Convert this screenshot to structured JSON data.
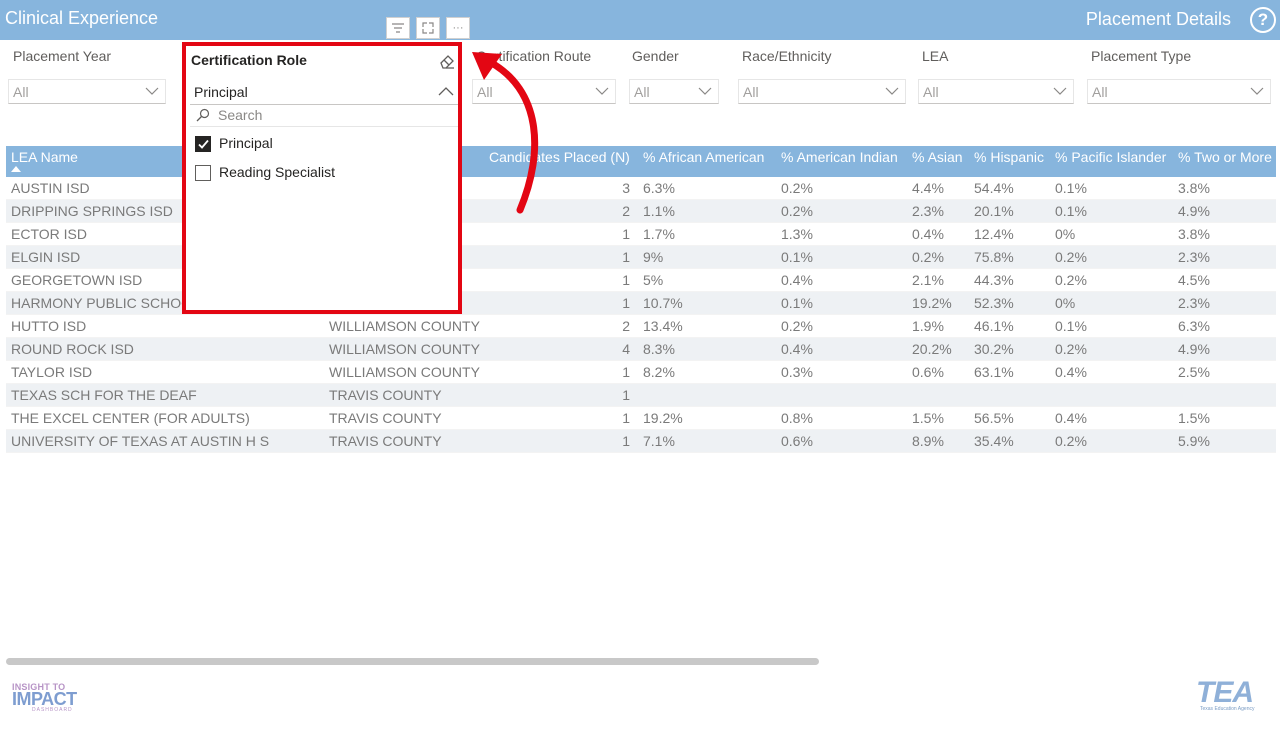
{
  "header": {
    "app_title": "Clinical Experience",
    "page_title": "Placement Details",
    "help_glyph": "?"
  },
  "visual_header": {
    "more_glyph": "···"
  },
  "slicers": [
    {
      "label": "Placement Year",
      "value": "All"
    },
    {
      "label": "Certification Route",
      "value": "All"
    },
    {
      "label": "Gender",
      "value": "All"
    },
    {
      "label": "Race/Ethnicity",
      "value": "All"
    },
    {
      "label": "LEA",
      "value": "All"
    },
    {
      "label": "Placement Type",
      "value": "All"
    }
  ],
  "dropdown": {
    "title": "Certification Role",
    "selected": "Principal",
    "search_placeholder": "Search",
    "items": [
      {
        "label": "Principal",
        "checked": true
      },
      {
        "label": "Reading Specialist",
        "checked": false
      }
    ]
  },
  "table": {
    "headers": [
      "LEA Name",
      "Candidates Placed (N)",
      "% African American",
      "% American Indian",
      "% Asian",
      "% Hispanic",
      "% Pacific Islander",
      "% Two or More"
    ],
    "rows": [
      {
        "lea": "AUSTIN ISD",
        "county": "",
        "n": "3",
        "aa": "6.3%",
        "ai": "0.2%",
        "as": "4.4%",
        "hi": "54.4%",
        "pi": "0.1%",
        "tm": "3.8%"
      },
      {
        "lea": "DRIPPING SPRINGS ISD",
        "county": "",
        "n": "2",
        "aa": "1.1%",
        "ai": "0.2%",
        "as": "2.3%",
        "hi": "20.1%",
        "pi": "0.1%",
        "tm": "4.9%"
      },
      {
        "lea": "ECTOR ISD",
        "county": "",
        "n": "1",
        "aa": "1.7%",
        "ai": "1.3%",
        "as": "0.4%",
        "hi": "12.4%",
        "pi": "0%",
        "tm": "3.8%"
      },
      {
        "lea": "ELGIN ISD",
        "county": "",
        "n": "1",
        "aa": "9%",
        "ai": "0.1%",
        "as": "0.2%",
        "hi": "75.8%",
        "pi": "0.2%",
        "tm": "2.3%"
      },
      {
        "lea": "GEORGETOWN ISD",
        "county": "TY",
        "n": "1",
        "aa": "5%",
        "ai": "0.4%",
        "as": "2.1%",
        "hi": "44.3%",
        "pi": "0.2%",
        "tm": "4.5%"
      },
      {
        "lea": "HARMONY PUBLIC SCHOO",
        "county": "",
        "n": "1",
        "aa": "10.7%",
        "ai": "0.1%",
        "as": "19.2%",
        "hi": "52.3%",
        "pi": "0%",
        "tm": "2.3%"
      },
      {
        "lea": "HUTTO ISD",
        "county": "WILLIAMSON COUNTY",
        "n": "2",
        "aa": "13.4%",
        "ai": "0.2%",
        "as": "1.9%",
        "hi": "46.1%",
        "pi": "0.1%",
        "tm": "6.3%"
      },
      {
        "lea": "ROUND ROCK ISD",
        "county": "WILLIAMSON COUNTY",
        "n": "4",
        "aa": "8.3%",
        "ai": "0.4%",
        "as": "20.2%",
        "hi": "30.2%",
        "pi": "0.2%",
        "tm": "4.9%"
      },
      {
        "lea": "TAYLOR ISD",
        "county": "WILLIAMSON COUNTY",
        "n": "1",
        "aa": "8.2%",
        "ai": "0.3%",
        "as": "0.6%",
        "hi": "63.1%",
        "pi": "0.4%",
        "tm": "2.5%"
      },
      {
        "lea": "TEXAS SCH FOR THE DEAF",
        "county": "TRAVIS COUNTY",
        "n": "1",
        "aa": "",
        "ai": "",
        "as": "",
        "hi": "",
        "pi": "",
        "tm": ""
      },
      {
        "lea": "THE EXCEL CENTER (FOR ADULTS)",
        "county": "TRAVIS COUNTY",
        "n": "1",
        "aa": "19.2%",
        "ai": "0.8%",
        "as": "1.5%",
        "hi": "56.5%",
        "pi": "0.4%",
        "tm": "1.5%"
      },
      {
        "lea": "UNIVERSITY OF TEXAS AT AUSTIN H S",
        "county": "TRAVIS COUNTY",
        "n": "1",
        "aa": "7.1%",
        "ai": "0.6%",
        "as": "8.9%",
        "hi": "35.4%",
        "pi": "0.2%",
        "tm": "5.9%"
      }
    ]
  },
  "logos": {
    "left_line1": "INSIGHT TO",
    "left_line2": "IMPACT",
    "left_line3": "DASHBOARD",
    "right_main": "TEA",
    "right_sub": "Texas Education Agency"
  },
  "colors": {
    "header_bg": "#87b5dd",
    "highlight_border": "#e30613",
    "row_alt": "#eef1f4"
  }
}
